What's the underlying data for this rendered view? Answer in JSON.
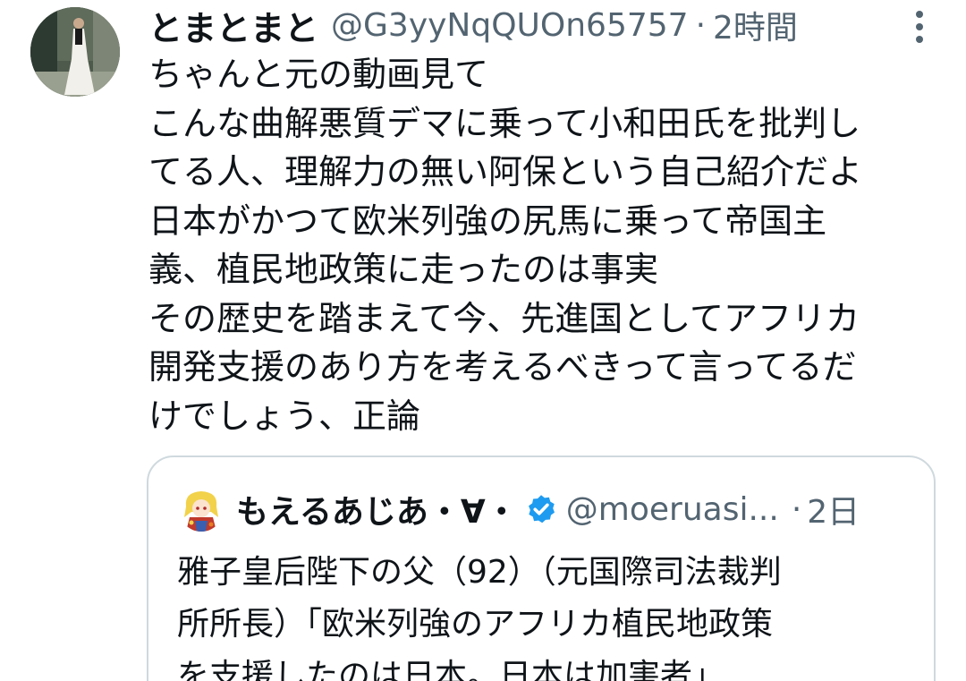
{
  "tweet": {
    "display_name": "とまとまと",
    "handle": "@G3yyNqQUOn65757",
    "separator": "·",
    "time": "2時間",
    "lines": [
      "ちゃんと元の動画見て",
      "こんな曲解悪質デマに乗って小和田氏を批判し",
      "てる人、理解力の無い阿保という自己紹介だよ",
      "日本がかつて欧米列強の尻馬に乗って帝国主",
      "義、植民地政策に走ったのは事実",
      "その歴史を踏まえて今、先進国としてアフリカ",
      "開発支援のあり方を考えるべきって言ってるだ",
      "けでしょう、正論"
    ],
    "avatar_icon": "profile-photo",
    "more_icon": "more-vertical-icon"
  },
  "quote": {
    "display_name": "もえるあじあ・∀・",
    "handle": "@moeruasi...",
    "separator": "·",
    "time": "2日",
    "verified_icon": "verified-badge-icon",
    "lines": [
      "雅子皇后陛下の父（92）（元国際司法裁判",
      "所所長）「欧米列強のアフリカ植民地政策",
      "を支援したのは日本。日本は加害者」"
    ]
  },
  "colors": {
    "text_primary": "#0f1419",
    "text_secondary": "#536471",
    "border": "#cfd9de",
    "verified": "#1d9bf0"
  }
}
